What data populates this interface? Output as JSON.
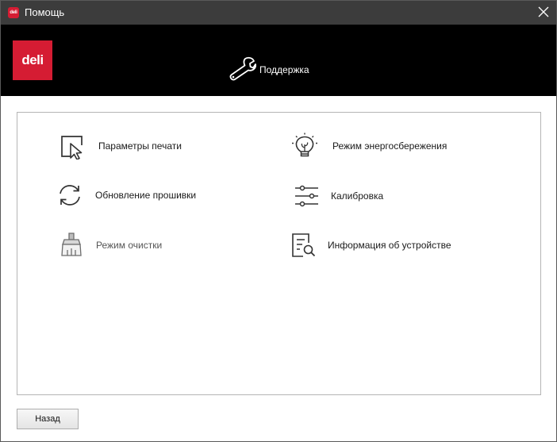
{
  "window": {
    "title": "Помощь",
    "app_icon_text": "deli"
  },
  "header": {
    "logo_text": "deli",
    "support_label": "Поддержка"
  },
  "menu": {
    "print_settings": "Параметры печати",
    "power_saving": "Режим энергосбережения",
    "firmware_update": "Обновление прошивки",
    "calibration": "Калибровка",
    "cleaning_mode": "Режим очистки",
    "device_info": "Информация об устройстве"
  },
  "footer": {
    "back_label": "Назад"
  },
  "colors": {
    "brand_red": "#d51c33",
    "header_bg": "#000000",
    "titlebar_bg": "#3c3c3c"
  },
  "icons": [
    "cursor-frame-icon",
    "lightbulb-icon",
    "refresh-icon",
    "sliders-icon",
    "broom-icon",
    "document-search-icon",
    "wrench-icon",
    "close-icon"
  ]
}
